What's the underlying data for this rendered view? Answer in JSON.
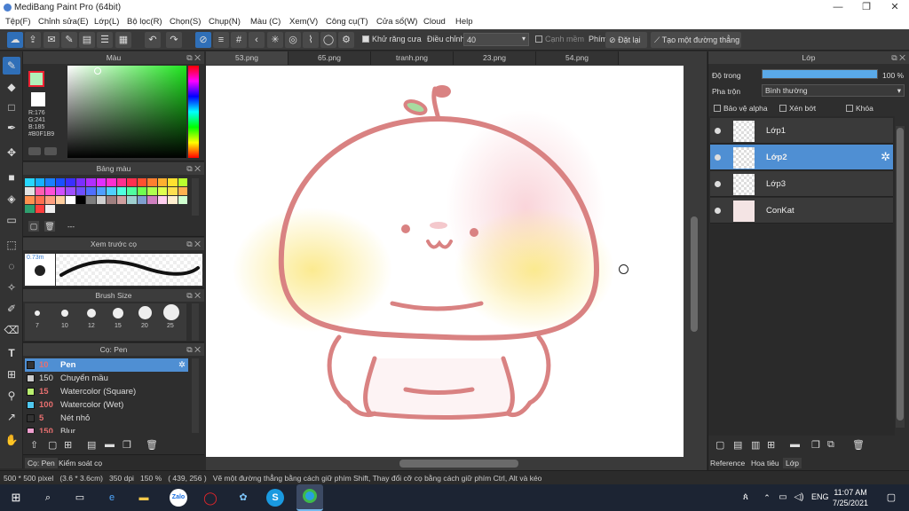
{
  "window": {
    "title": "MediBang Paint Pro (64bit)",
    "minimize": "—",
    "maximize": "❐",
    "close": "✕"
  },
  "menu": [
    "Tệp(F)",
    "Chỉnh sửa(E)",
    "Lớp(L)",
    "Bộ lọc(R)",
    "Chọn(S)",
    "Chụp(N)",
    "Màu (C)",
    "Xem(V)",
    "Công cụ(T)",
    "Cửa sổ(W)",
    "Cloud",
    "Help"
  ],
  "toolbar": {
    "antialias_label": "Khử răng cưa",
    "adjust_label": "Điều chỉnh",
    "adjust_value": "40",
    "edge_label": "Cạnh mềm",
    "phim_label": "Phím",
    "reset_label": "Đặt lại",
    "line_label": "Tạo một đường thẳng"
  },
  "color_panel": {
    "title": "Màu",
    "r": "R:176",
    "g": "G:241",
    "b": "B:185",
    "hex": "#B0F1B9",
    "primary_color": "#B0F1B9"
  },
  "palette_panel": {
    "title": "Bảng màu",
    "extra": "---",
    "swatches": [
      "#27d7ff",
      "#16b0ff",
      "#1a7fff",
      "#1a4fff",
      "#3a2fff",
      "#7a2fff",
      "#b02fff",
      "#e02fff",
      "#ff2fd0",
      "#ff2f90",
      "#ff2f4f",
      "#ff4f2f",
      "#ff7f2f",
      "#ffb02f",
      "#ffe02f",
      "#b9ff2f",
      "#e2e2e2",
      "#ff5fb0",
      "#ff4fd7",
      "#d04fff",
      "#9f4fff",
      "#6f4fff",
      "#4f6fff",
      "#4f9fff",
      "#4fd0ff",
      "#4fffe0",
      "#4fffa0",
      "#6fff4f",
      "#b0ff4f",
      "#e0ff4f",
      "#ffe04f",
      "#ffb04f",
      "#ff904f",
      "#ff6f4f",
      "#ffa07f",
      "#ffcf9f",
      "#ffffff",
      "#000000",
      "#7f7f7f",
      "#cfcfcf",
      "#9f7f7f",
      "#cf9f9f",
      "#9fcfcf",
      "#7f9fcf",
      "#cf7fbf",
      "#ffcfef",
      "#ffefcf",
      "#cfffcf",
      "#2f9f6f",
      "#ff3f3f",
      "#efefef"
    ]
  },
  "preview_panel": {
    "title": "Xem trước cọ",
    "size": "0.73m"
  },
  "brushsize_panel": {
    "title": "Brush Size",
    "sizes": [
      "7",
      "10",
      "12",
      "15",
      "20",
      "25"
    ]
  },
  "brush_panel": {
    "title": "Cọ: Pen",
    "items": [
      {
        "num": "10",
        "name": "Pen",
        "color": "#333333"
      },
      {
        "num": "150",
        "name": "Chuyển mầu",
        "color": "#cccccc"
      },
      {
        "num": "15",
        "name": "Watercolor (Square)",
        "color": "#b9ef6f"
      },
      {
        "num": "100",
        "name": "Watercolor (Wet)",
        "color": "#4fc8f0"
      },
      {
        "num": "5",
        "name": "Nét nhỏ",
        "color": "#333333"
      },
      {
        "num": "150",
        "name": "Blur",
        "color": "#ef9fcf"
      }
    ]
  },
  "left_bottom_tabs": [
    "Cọ: Pen",
    "Kiểm soát cọ"
  ],
  "canvas_tabs": [
    "53.png",
    "65.png",
    "tranh.png",
    "23.png",
    "54.png"
  ],
  "layer_panel": {
    "title": "Lớp",
    "opacity_label": "Độ trong",
    "opacity_value": "100 %",
    "opacity_fraction": 1.0,
    "blend_label": "Pha trộn",
    "blend_value": "Bình thường",
    "protect_alpha": "Bảo vệ alpha",
    "clipping": "Xén bớt",
    "lock": "Khóa",
    "layers": [
      {
        "name": "Lớp1",
        "selected": false
      },
      {
        "name": "Lớp2",
        "selected": true
      },
      {
        "name": "Lớp3",
        "selected": false
      },
      {
        "name": "ConKat",
        "selected": false
      }
    ]
  },
  "right_bottom_tabs": [
    "Reference",
    "Hoa tiêu",
    "Lớp"
  ],
  "status": {
    "text": "500 * 500 pixel   (3.6 * 3.6cm)   350 dpi   150 %   ( 439, 256 )   Vẽ một đường thẳng bằng cách giữ phím Shift, Thay đổi cỡ cọ bằng cách giữ phím Ctrl, Alt và kéo"
  },
  "taskbar": {
    "lang": "ENG",
    "time": "11:07 AM",
    "date": "7/25/2021"
  }
}
